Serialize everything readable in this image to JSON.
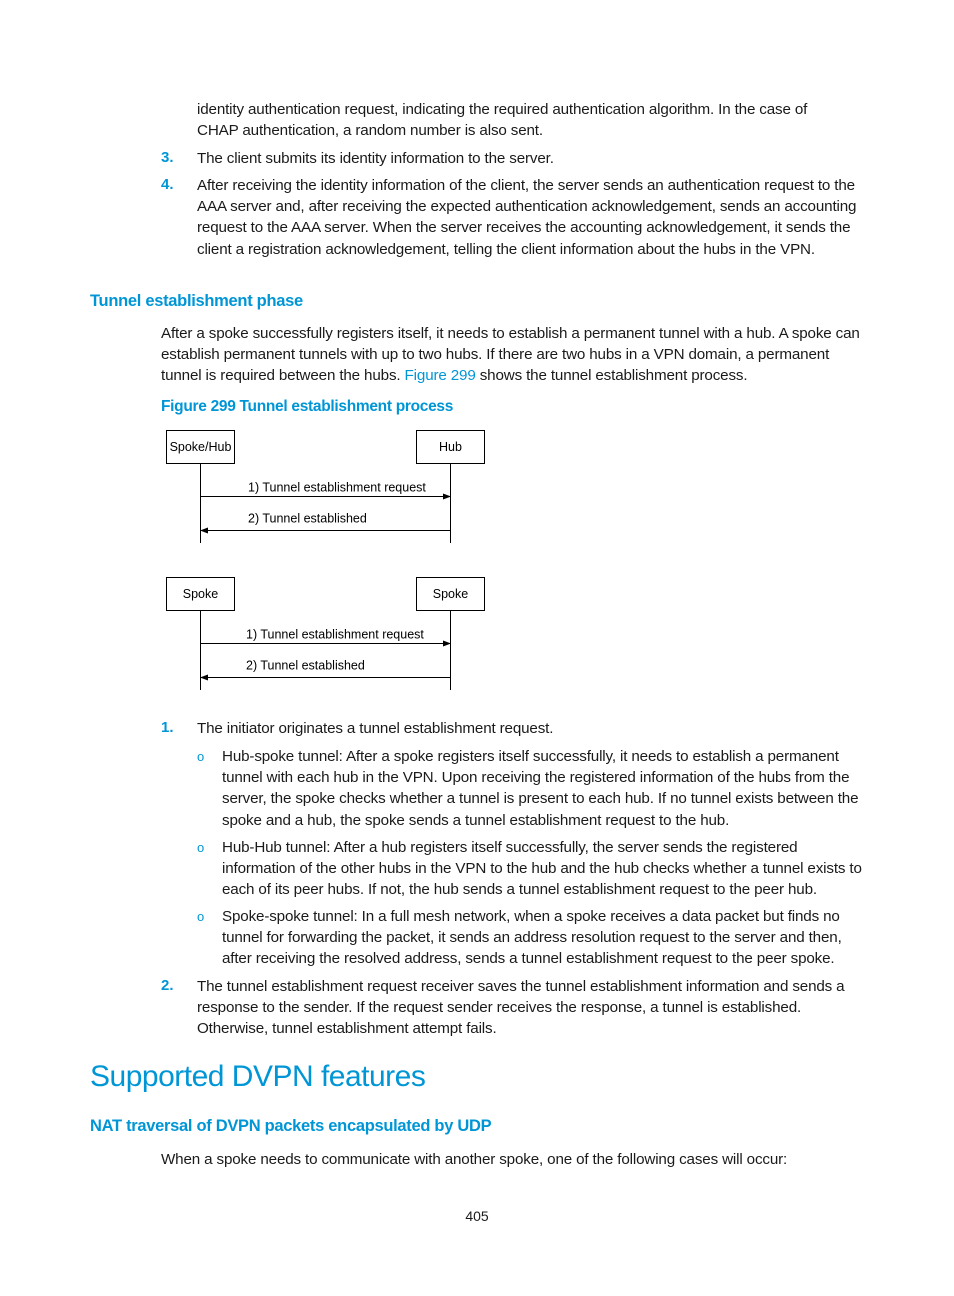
{
  "continuation": {
    "lines": [
      "identity authentication request, indicating the required authentication algorithm. In the case of",
      "CHAP authentication, a random number is also sent."
    ]
  },
  "steps_top": [
    {
      "num": "3.",
      "text": "The client submits its identity information to the server."
    },
    {
      "num": "4.",
      "text": "After receiving the identity information of the client, the server sends an authentication request to the AAA server and, after receiving the expected authentication acknowledgement, sends an accounting request to the AAA server. When the server receives the accounting acknowledgement, it sends the client a registration acknowledgement, telling the client information about the hubs in the VPN."
    }
  ],
  "section_tunnel": {
    "heading": "Tunnel establishment phase",
    "para_before_link": "After a spoke successfully registers itself, it needs to establish a permanent tunnel with a hub. A spoke can establish permanent tunnels with up to two hubs. If there are two hubs in a VPN domain, a permanent tunnel is required between the hubs.",
    "link_text": "Figure 299",
    "para_after_link": "shows the tunnel establishment process.",
    "figure_caption": "Figure 299 Tunnel establishment process"
  },
  "figure": {
    "diagram1": {
      "left_node": "Spoke/Hub",
      "right_node": "Hub",
      "msg1": "1) Tunnel establishment request",
      "msg2": "2) Tunnel established"
    },
    "diagram2": {
      "left_node": "Spoke",
      "right_node": "Spoke",
      "msg1": "1) Tunnel establishment request",
      "msg2": "2) Tunnel established"
    }
  },
  "steps_bottom": [
    {
      "num": "1.",
      "text": "The initiator originates a tunnel establishment request.",
      "bullets": [
        "Hub-spoke tunnel: After a spoke registers itself successfully, it needs to establish a permanent tunnel with each hub in the VPN. Upon receiving the registered information of the hubs from the server, the spoke checks whether a tunnel is present to each hub. If no tunnel exists between the spoke and a hub, the spoke sends a tunnel establishment request to the hub.",
        "Hub-Hub tunnel: After a hub registers itself successfully, the server sends the registered information of the other hubs in the VPN to the hub and the hub checks whether a tunnel exists to each of its peer hubs. If not, the hub sends a tunnel establishment request to the peer hub.",
        "Spoke-spoke tunnel: In a full mesh network, when a spoke receives a data packet but finds no tunnel for forwarding the packet, it sends an address resolution request to the server and then, after receiving the resolved address, sends a tunnel establishment request to the peer spoke."
      ]
    },
    {
      "num": "2.",
      "text": "The tunnel establishment request receiver saves the tunnel establishment information and sends a response to the sender. If the request sender receives the response, a tunnel is established. Otherwise, tunnel establishment attempt fails."
    }
  ],
  "section_features": {
    "heading": "Supported DVPN features",
    "subheading": "NAT traversal of DVPN packets encapsulated by UDP",
    "para": "When a spoke needs to communicate with another spoke, one of the following cases will occur:"
  },
  "bullet_glyph": "o",
  "page_number": "405"
}
